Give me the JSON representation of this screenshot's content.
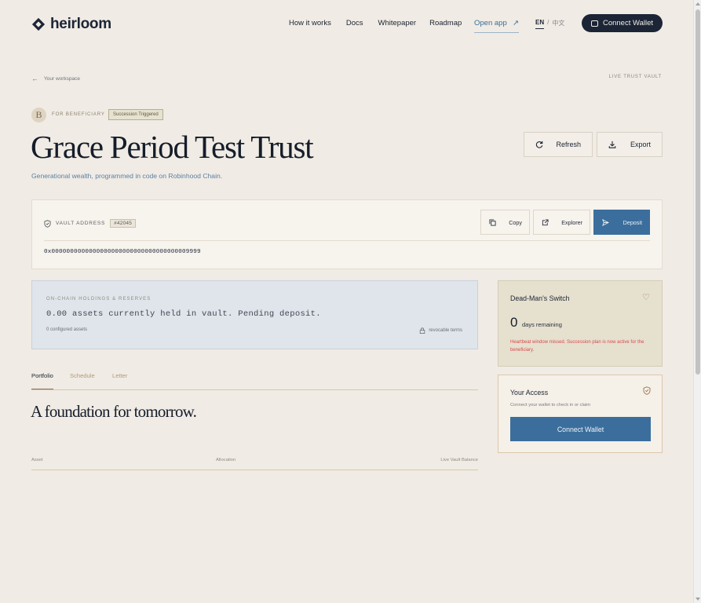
{
  "header": {
    "logo_text": "heirloom",
    "nav": [
      "How it works",
      "Docs",
      "Whitepaper",
      "Roadmap"
    ],
    "open_app": "Open app",
    "lang_en": "EN",
    "lang_sep": "/",
    "lang_zh": "中文",
    "connect_wallet": "Connect Wallet"
  },
  "breadcrumb": {
    "back_label": "Your workspace",
    "status_label": "LIVE TRUST VAULT"
  },
  "trust": {
    "avatar_initial": "B",
    "role_label": "FOR BENEFICIARY",
    "status_badge": "Succession Triggered",
    "title": "Grace Period Test Trust",
    "subtitle": "Generational wealth, programmed in code on Robinhood Chain.",
    "refresh_label": "Refresh",
    "export_label": "Export"
  },
  "vault": {
    "label": "VAULT ADDRESS",
    "number": "#42045",
    "copy_label": "Copy",
    "explorer_label": "Explorer",
    "deposit_label": "Deposit",
    "address": "0x0000000000000000000000000000000000009999"
  },
  "holdings": {
    "label": "ON-CHAIN HOLDINGS & RESERVES",
    "message": "0.00 assets currently held in vault. Pending deposit.",
    "configured": "0 configured assets",
    "terms": "revocable terms"
  },
  "tabs": [
    "Portfolio",
    "Schedule",
    "Letter"
  ],
  "portfolio": {
    "heading": "A foundation for tomorrow.",
    "columns": [
      "Asset",
      "Allocation",
      "Live Vault Balance"
    ]
  },
  "deadman": {
    "title": "Dead-Man's Switch",
    "days": "0",
    "days_label": "days remaining",
    "warning": "Heartbeat window missed. Succession plan is now active for the beneficiary."
  },
  "access": {
    "title": "Your Access",
    "subtitle": "Connect your wallet to check in or claim",
    "button": "Connect Wallet"
  },
  "colors": {
    "background": "#f0ebe4",
    "navy": "#1b2536",
    "accent_blue": "#3b6e9c",
    "warning_red": "#d64b4b"
  }
}
